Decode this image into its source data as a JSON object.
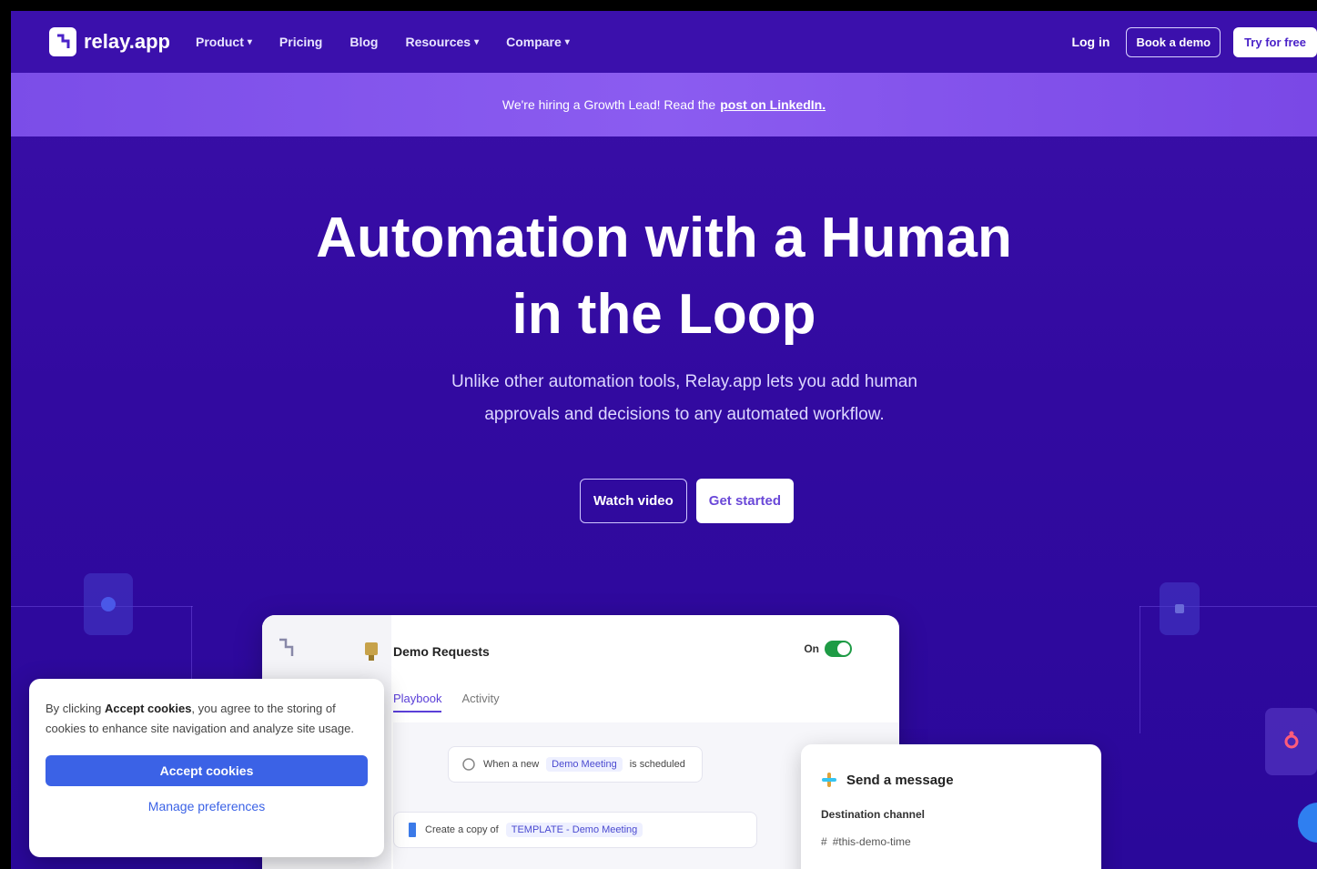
{
  "nav": {
    "logo_text": "relay.app",
    "links": [
      {
        "label": "Product",
        "dropdown": true
      },
      {
        "label": "Pricing",
        "dropdown": false
      },
      {
        "label": "Blog",
        "dropdown": false
      },
      {
        "label": "Resources",
        "dropdown": true
      },
      {
        "label": "Compare",
        "dropdown": true
      }
    ],
    "login": "Log in",
    "demo": "Book a demo",
    "try": "Try for free"
  },
  "banner": {
    "text": "We're hiring a Growth Lead! Read the",
    "link": "post on LinkedIn."
  },
  "hero": {
    "title_line1": "Automation with a Human",
    "title_line2": "in the Loop",
    "subtitle": "Unlike other automation tools, Relay.app lets you add human approvals and decisions to any automated workflow.",
    "watch_video": "Watch video",
    "get_started": "Get started"
  },
  "app": {
    "workflow_title": "Demo Requests",
    "toggle_label": "On",
    "tabs": [
      "Playbook",
      "Activity"
    ],
    "step1_prefix": "When a new",
    "step1_chip": "Demo Meeting",
    "step1_suffix": "is scheduled",
    "step2_prefix": "Create a copy of",
    "step2_chip": "TEMPLATE - Demo Meeting"
  },
  "side_panel": {
    "title": "Send a message",
    "label": "Destination channel",
    "value": "#this-demo-time"
  },
  "cookie": {
    "text_prefix": "By clicking",
    "text_bold": "Accept cookies",
    "text_suffix": ", you agree to the storing of cookies to enhance site navigation and analyze site usage.",
    "accept": "Accept cookies",
    "manage": "Manage preferences"
  },
  "colors": {
    "background": "#3a0fa8",
    "banner": "#8b5cf0",
    "accent_blue": "#3b62e6",
    "toggle_green": "#1e9b45"
  }
}
